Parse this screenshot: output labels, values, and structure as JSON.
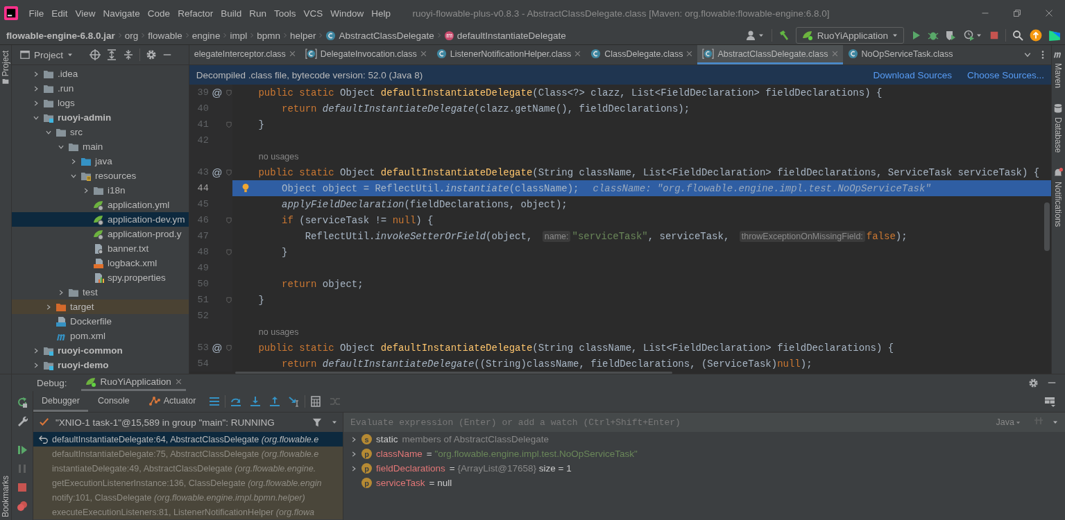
{
  "window": {
    "title": "ruoyi-flowable-plus-v0.8.3 - AbstractClassDelegate.class [Maven: org.flowable:flowable-engine:6.8.0]"
  },
  "menu": [
    "File",
    "Edit",
    "View",
    "Navigate",
    "Code",
    "Refactor",
    "Build",
    "Run",
    "Tools",
    "VCS",
    "Window",
    "Help"
  ],
  "breadcrumbs": [
    {
      "label": "flowable-engine-6.8.0.jar",
      "kind": "jar"
    },
    {
      "label": "org",
      "kind": "package"
    },
    {
      "label": "flowable",
      "kind": "package"
    },
    {
      "label": "engine",
      "kind": "package"
    },
    {
      "label": "impl",
      "kind": "package"
    },
    {
      "label": "bpmn",
      "kind": "package"
    },
    {
      "label": "helper",
      "kind": "package"
    },
    {
      "label": "AbstractClassDelegate",
      "kind": "class"
    },
    {
      "label": "defaultInstantiateDelegate",
      "kind": "method"
    }
  ],
  "run_configuration": "RuoYiApplication",
  "left_strip": [
    "Project"
  ],
  "project": {
    "title": "Project",
    "tree": [
      {
        "name": ".idea",
        "kind": "folder",
        "expanded": false,
        "selected": false
      },
      {
        "name": ".run",
        "kind": "folder",
        "expanded": false,
        "selected": false
      },
      {
        "name": "logs",
        "kind": "folder",
        "expanded": false,
        "selected": false
      },
      {
        "name": "ruoyi-admin",
        "kind": "module",
        "expanded": true,
        "selected": false,
        "children": [
          {
            "name": "src",
            "kind": "folder",
            "expanded": true,
            "selected": false,
            "children": [
              {
                "name": "main",
                "kind": "folder",
                "expanded": true,
                "selected": false,
                "children": [
                  {
                    "name": "java",
                    "kind": "source-folder",
                    "expanded": false,
                    "selected": false
                  },
                  {
                    "name": "resources",
                    "kind": "resource-folder",
                    "expanded": true,
                    "selected": false,
                    "children": [
                      {
                        "name": "i18n",
                        "kind": "folder",
                        "expanded": false,
                        "selected": false
                      },
                      {
                        "name": "application.yml",
                        "kind": "spring-file",
                        "selected": false
                      },
                      {
                        "name": "application-dev.ym",
                        "kind": "spring-file",
                        "selected": true
                      },
                      {
                        "name": "application-prod.y",
                        "kind": "spring-file",
                        "selected": false
                      },
                      {
                        "name": "banner.txt",
                        "kind": "text-file",
                        "selected": false
                      },
                      {
                        "name": "logback.xml",
                        "kind": "xml-file",
                        "selected": false
                      },
                      {
                        "name": "spy.properties",
                        "kind": "properties-file",
                        "selected": false
                      }
                    ]
                  }
                ]
              },
              {
                "name": "test",
                "kind": "folder",
                "expanded": false,
                "selected": false
              }
            ]
          },
          {
            "name": "target",
            "kind": "excluded-folder",
            "expanded": false,
            "selected": false
          },
          {
            "name": "Dockerfile",
            "kind": "docker-file",
            "selected": false
          },
          {
            "name": "pom.xml",
            "kind": "maven-file",
            "selected": false
          }
        ]
      },
      {
        "name": "ruoyi-common",
        "kind": "module",
        "expanded": false,
        "selected": false
      },
      {
        "name": "ruoyi-demo",
        "kind": "module",
        "expanded": false,
        "selected": false
      }
    ]
  },
  "editor": {
    "tabs": [
      {
        "label": "elegateInterceptor.class",
        "kind": "cut",
        "selected": false,
        "closable": true
      },
      {
        "label": "DelegateInvocation.class",
        "kind": "decompiled-class",
        "selected": false,
        "closable": true
      },
      {
        "label": "ListenerNotificationHelper.class",
        "kind": "class",
        "selected": false,
        "closable": true
      },
      {
        "label": "ClassDelegate.class",
        "kind": "class",
        "selected": false,
        "closable": true
      },
      {
        "label": "AbstractClassDelegate.class",
        "kind": "decompiled-class",
        "selected": true,
        "closable": true
      },
      {
        "label": "NoOpServiceTask.class",
        "kind": "class",
        "selected": false,
        "closable": false
      }
    ],
    "banner": {
      "text": "Decompiled .class file, bytecode version: 52.0 (Java 8)",
      "actions": [
        "Download Sources",
        "Choose Sources..."
      ]
    },
    "lines": [
      {
        "kind": "code",
        "number": "39",
        "marker": "@",
        "fold": true,
        "highlighted": false,
        "tokens": [
          {
            "kind": "kw",
            "text": "    public static "
          },
          {
            "kind": "text",
            "text": "Object "
          },
          {
            "kind": "decl",
            "text": "defaultInstantiateDelegate"
          },
          {
            "kind": "text",
            "text": "(Class<?> clazz, List<FieldDeclaration> fieldDeclarations) {"
          }
        ]
      },
      {
        "kind": "code",
        "number": "40",
        "fold": false,
        "highlighted": false,
        "tokens": [
          {
            "kind": "kw",
            "text": "        return "
          },
          {
            "kind": "italic",
            "text": "defaultInstantiateDelegate"
          },
          {
            "kind": "text",
            "text": "(clazz.getName(), fieldDeclarations);"
          }
        ]
      },
      {
        "kind": "code",
        "number": "41",
        "fold": true,
        "highlighted": false,
        "tokens": [
          {
            "kind": "text",
            "text": "    }"
          }
        ]
      },
      {
        "kind": "code",
        "number": "42",
        "fold": false,
        "highlighted": false
      },
      {
        "kind": "usage",
        "text": "no usages"
      },
      {
        "kind": "code",
        "number": "43",
        "marker": "@",
        "fold": true,
        "highlighted": false,
        "tokens": [
          {
            "kind": "kw",
            "text": "    public static "
          },
          {
            "kind": "text",
            "text": "Object "
          },
          {
            "kind": "decl",
            "text": "defaultInstantiateDelegate"
          },
          {
            "kind": "text",
            "text": "(String className, List<FieldDeclaration> fieldDeclarations, ServiceTask serviceTask) {"
          }
        ]
      },
      {
        "kind": "code",
        "number": "44",
        "fold": false,
        "highlighted": true,
        "tokens": [
          {
            "kind": "text",
            "text": "        Object object = ReflectUtil."
          },
          {
            "kind": "italic",
            "text": "instantiate"
          },
          {
            "kind": "text",
            "text": "(className);"
          },
          {
            "kind": "debug",
            "text": "className: \"org.flowable.engine.impl.test.NoOpServiceTask\""
          }
        ]
      },
      {
        "kind": "code",
        "number": "45",
        "fold": false,
        "highlighted": false,
        "tokens": [
          {
            "kind": "italic",
            "text": "        applyFieldDeclaration"
          },
          {
            "kind": "text",
            "text": "(fieldDeclarations, object);"
          }
        ]
      },
      {
        "kind": "code",
        "number": "46",
        "fold": true,
        "highlighted": false,
        "tokens": [
          {
            "kind": "kw",
            "text": "        if "
          },
          {
            "kind": "text",
            "text": "(serviceTask != "
          },
          {
            "kind": "kw",
            "text": "null"
          },
          {
            "kind": "text",
            "text": ") {"
          }
        ]
      },
      {
        "kind": "code",
        "number": "47",
        "fold": false,
        "highlighted": false,
        "tokens": [
          {
            "kind": "text",
            "text": "            ReflectUtil."
          },
          {
            "kind": "italic",
            "text": "invokeSetterOrField"
          },
          {
            "kind": "text",
            "text": "(object, "
          },
          {
            "kind": "hint",
            "text": "name:"
          },
          {
            "kind": "str",
            "text": "\"serviceTask\""
          },
          {
            "kind": "text",
            "text": ", serviceTask, "
          },
          {
            "kind": "hint",
            "text": "throwExceptionOnMissingField:"
          },
          {
            "kind": "kw",
            "text": "false"
          },
          {
            "kind": "text",
            "text": ");"
          }
        ]
      },
      {
        "kind": "code",
        "number": "48",
        "fold": true,
        "highlighted": false,
        "tokens": [
          {
            "kind": "text",
            "text": "        }"
          }
        ]
      },
      {
        "kind": "code",
        "number": "49",
        "fold": false,
        "highlighted": false
      },
      {
        "kind": "code",
        "number": "50",
        "fold": false,
        "highlighted": false,
        "tokens": [
          {
            "kind": "kw",
            "text": "        return "
          },
          {
            "kind": "text",
            "text": "object;"
          }
        ]
      },
      {
        "kind": "code",
        "number": "51",
        "fold": true,
        "highlighted": false,
        "tokens": [
          {
            "kind": "text",
            "text": "    }"
          }
        ]
      },
      {
        "kind": "code",
        "number": "52",
        "fold": false,
        "highlighted": false
      },
      {
        "kind": "usage",
        "text": "no usages"
      },
      {
        "kind": "code",
        "number": "53",
        "marker": "@",
        "fold": true,
        "highlighted": false,
        "tokens": [
          {
            "kind": "kw",
            "text": "    public static "
          },
          {
            "kind": "text",
            "text": "Object "
          },
          {
            "kind": "decl",
            "text": "defaultInstantiateDelegate"
          },
          {
            "kind": "text",
            "text": "(String className, List<FieldDeclaration> fieldDeclarations) {"
          }
        ]
      },
      {
        "kind": "code",
        "number": "54",
        "fold": false,
        "highlighted": false,
        "tokens": [
          {
            "kind": "kw",
            "text": "        return "
          },
          {
            "kind": "italic",
            "text": "defaultInstantiateDelegate"
          },
          {
            "kind": "text",
            "text": "((String)className, fieldDeclarations, (ServiceTask)"
          },
          {
            "kind": "kw",
            "text": "null"
          },
          {
            "kind": "text",
            "text": ");"
          }
        ]
      }
    ]
  },
  "right_strip": [
    {
      "label": "Maven",
      "kind": "maven"
    },
    {
      "label": "Database",
      "kind": "database"
    },
    {
      "label": "Notifications",
      "kind": "notifications"
    }
  ],
  "debug": {
    "label": "Debug:",
    "session": {
      "label": "RuoYiApplication",
      "selected": true
    },
    "bookmarks_label": "Bookmarks",
    "tabs": [
      {
        "label": "Debugger",
        "selected": true
      },
      {
        "label": "Console",
        "selected": false
      },
      {
        "label": "Actuator",
        "kind": "actuator",
        "selected": false
      }
    ],
    "thread": "\"XNIO-1 task-1\"@15,589 in group \"main\": RUNNING",
    "frames": [
      {
        "text": "defaultInstantiateDelegate:64, AbstractClassDelegate *(org.flowable.e*",
        "selected": true
      },
      {
        "text": "defaultInstantiateDelegate:75, AbstractClassDelegate *(org.flowable.e*",
        "selected": false
      },
      {
        "text": "instantiateDelegate:49, AbstractClassDelegate *(org.flowable.engine.*",
        "selected": false
      },
      {
        "text": "getExecutionListenerInstance:136, ClassDelegate *(org.flowable.engin*",
        "selected": false
      },
      {
        "text": "notify:101, ClassDelegate *(org.flowable.engine.impl.bpmn.helper)*",
        "selected": false
      },
      {
        "text": "executeExecutionListeners:81, ListenerNotificationHelper *(org.flowa*",
        "selected": false
      }
    ],
    "evaluate": {
      "placeholder": "Evaluate expression (Enter) or add a watch (Ctrl+Shift+Enter)",
      "language": "Java"
    },
    "variables": [
      {
        "badge": "s",
        "name": "static",
        "value": "members of AbstractClassDelegate",
        "kind": "static",
        "expandable": true
      },
      {
        "badge": "p",
        "name": "className",
        "operator": "=",
        "value": "\"org.flowable.engine.impl.test.NoOpServiceTask\"",
        "kind": "string",
        "expandable": true
      },
      {
        "badge": "p",
        "name": "fieldDeclarations",
        "operator": "=",
        "value": "{ArrayList@17658}",
        "extra": "size = 1",
        "kind": "object",
        "expandable": true
      },
      {
        "badge": "p",
        "name": "serviceTask",
        "operator": "=",
        "value": "null",
        "kind": "null",
        "expandable": false
      }
    ]
  }
}
